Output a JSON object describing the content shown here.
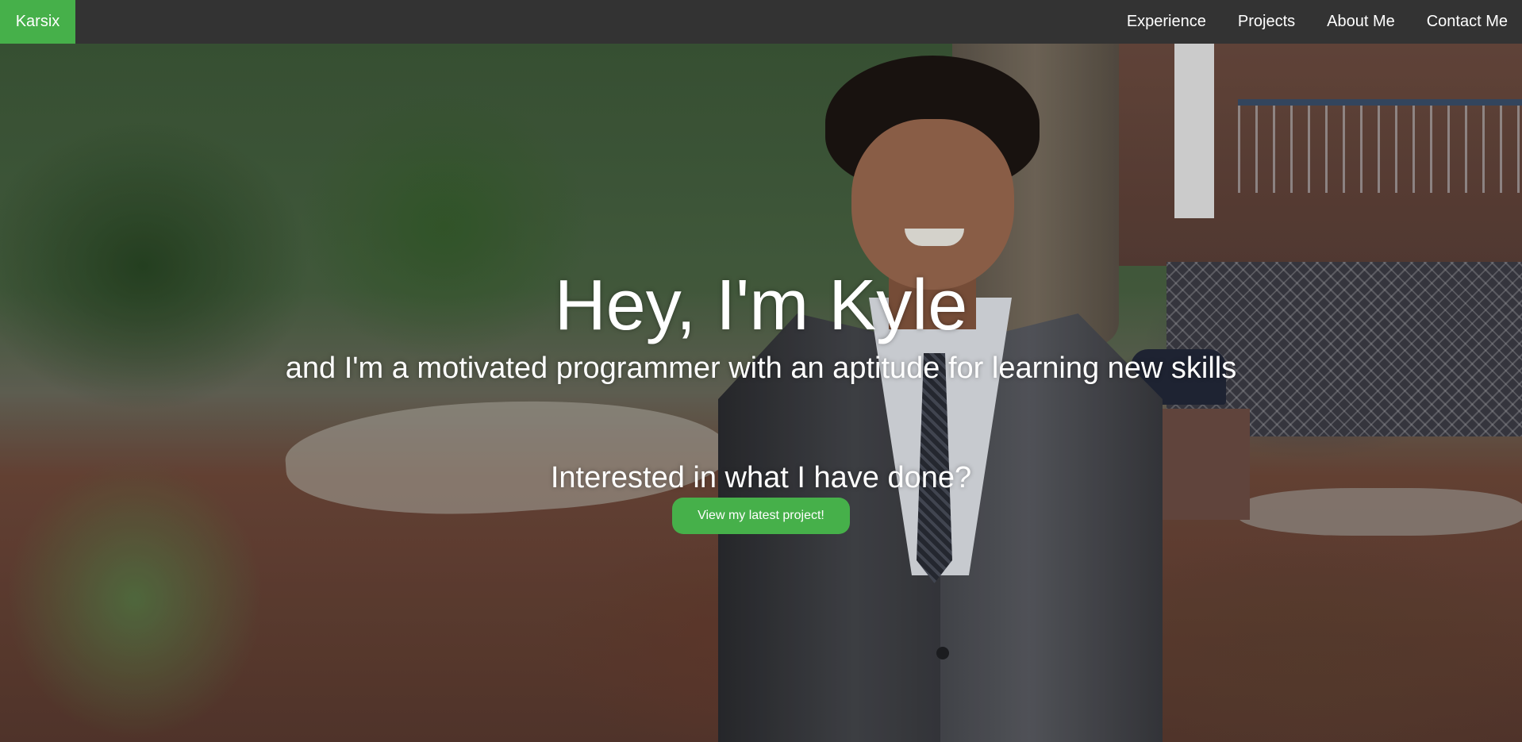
{
  "navbar": {
    "brand": "Karsix",
    "links": [
      {
        "label": "Experience"
      },
      {
        "label": "Projects"
      },
      {
        "label": "About Me"
      },
      {
        "label": "Contact Me"
      }
    ],
    "bg_color": "#333333",
    "brand_color": "#46b04a"
  },
  "hero": {
    "headline": "Hey, I'm Kyle",
    "tagline": "and I'm a motivated programmer with an aptitude for learning new skills",
    "cta_prompt": "Interested in what I have done?",
    "cta_button": "View my latest project!",
    "accent_color": "#46b04a",
    "background_image": "photo of Kyle in a suit standing outdoors among trees"
  }
}
